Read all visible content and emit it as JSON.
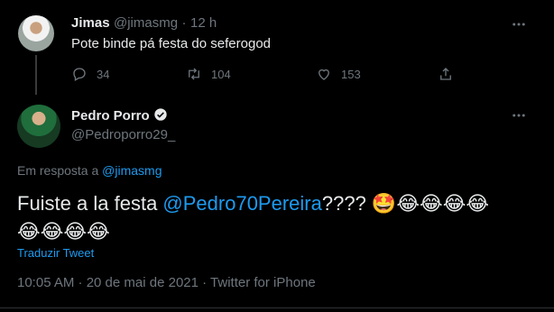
{
  "reply": {
    "name": "Jimas",
    "handle": "@jimasmg",
    "separator": "·",
    "time": "12 h",
    "text": "Pote binde pá festa do seferogod",
    "replies": "34",
    "retweets": "104",
    "likes": "153"
  },
  "tweet": {
    "name": "Pedro Porro",
    "handle": "@Pedroporro29_",
    "replying_prefix": "Em resposta a",
    "replying_to": "@jimasmg",
    "text_before": "Fuiste a la festa ",
    "mention": "@Pedro70Pereira",
    "text_after": "????  ",
    "emoji_line1": "🤩😂😂😂😂",
    "emoji_line2": "😂😂😂😂",
    "translate": "Traduzir Tweet",
    "meta": "10:05 AM · 20 de mai de 2021 · Twitter for iPhone"
  },
  "icons": {
    "more": "more-horizontal-icon",
    "reply": "reply-icon",
    "retweet": "retweet-icon",
    "like": "heart-icon",
    "share": "share-icon",
    "verified": "verified-badge-icon"
  },
  "colors": {
    "background": "#000000",
    "link": "#1d9bf0",
    "muted": "#6e767d",
    "text": "#e7e9ea"
  }
}
